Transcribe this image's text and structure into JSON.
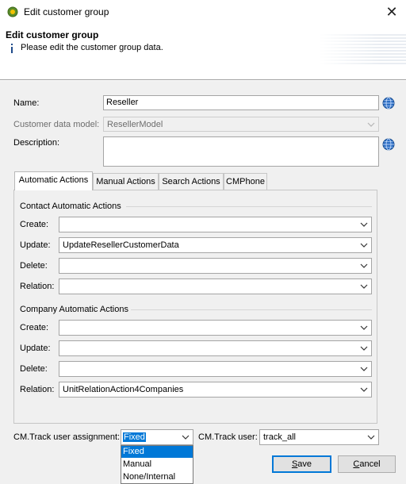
{
  "window": {
    "title": "Edit customer group",
    "close_glyph": "✕"
  },
  "header": {
    "title": "Edit customer group",
    "message": "Please edit the customer group data."
  },
  "form": {
    "name_label": "Name:",
    "name_value": "Reseller",
    "model_label": "Customer data model:",
    "model_value": "ResellerModel",
    "description_label": "Description:",
    "description_value": ""
  },
  "tabs": [
    {
      "label": "Automatic Actions",
      "active": true
    },
    {
      "label": "Manual Actions",
      "active": false
    },
    {
      "label": "Search Actions",
      "active": false
    },
    {
      "label": "CMPhone",
      "active": false
    }
  ],
  "contact_group": {
    "title": "Contact Automatic Actions",
    "rows": [
      {
        "label": "Create:",
        "value": ""
      },
      {
        "label": "Update:",
        "value": "UpdateResellerCustomerData"
      },
      {
        "label": "Delete:",
        "value": ""
      },
      {
        "label": "Relation:",
        "value": ""
      }
    ]
  },
  "company_group": {
    "title": "Company Automatic Actions",
    "rows": [
      {
        "label": "Create:",
        "value": ""
      },
      {
        "label": "Update:",
        "value": ""
      },
      {
        "label": "Delete:",
        "value": ""
      },
      {
        "label": "Relation:",
        "value": "UnitRelationAction4Companies"
      }
    ]
  },
  "bottom": {
    "assignment_label": "CM.Track user assignment:",
    "assignment_value": "Fixed",
    "user_label": "CM.Track user:",
    "user_value": "track_all",
    "assignment_options": [
      "Fixed",
      "Manual",
      "None/Internal"
    ],
    "selected_option": "Fixed"
  },
  "buttons": {
    "save": "Save",
    "cancel": "Cancel"
  },
  "icons": {
    "app": "app-logo-icon",
    "info": "info-icon",
    "globe": "translate-globe-icon",
    "arrow": "chevron-down-icon",
    "close": "close-icon"
  },
  "colors": {
    "selection": "#0078d7",
    "default_button_border": "#0078d7",
    "dialog_bg": "#f0f0f0"
  }
}
